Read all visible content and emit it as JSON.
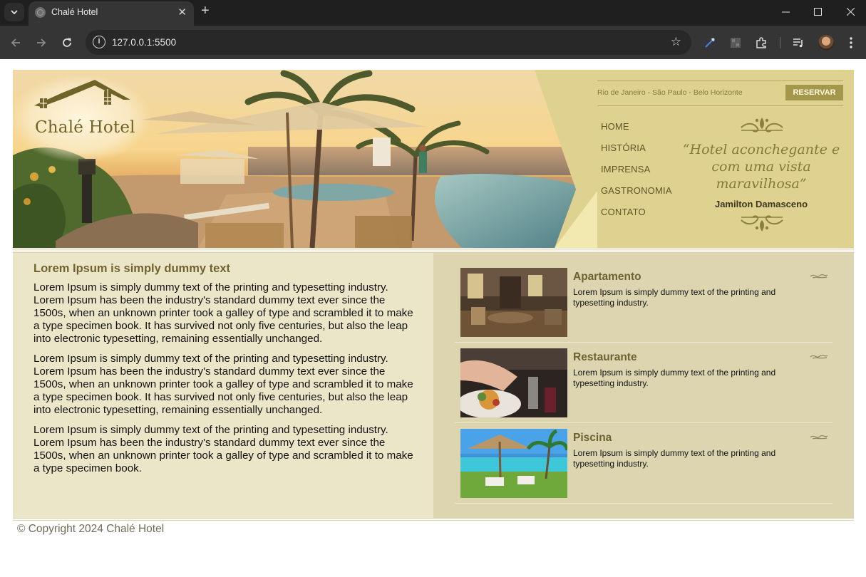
{
  "browser": {
    "tab_title": "Chalé Hotel",
    "url": "127.0.0.1:5500"
  },
  "site": {
    "logo_text": "Chalé Hotel",
    "cities": "Rio de Janeiro - São Paulo - Belo Horizonte",
    "reserve_label": "RESERVAR",
    "nav": [
      "HOME",
      "HISTÓRIA",
      "IMPRENSA",
      "GASTRONOMIA",
      "CONTATO"
    ],
    "quote": "“Hotel aconchegante e com uma vista maravilhosa”",
    "quote_author": "Jamilton Damasceno",
    "main_title": "Lorem Ipsum is simply dummy text",
    "paragraphs": [
      "Lorem Ipsum is simply dummy text of the printing and typesetting industry. Lorem Ipsum has been the industry's standard dummy text ever since the 1500s, when an unknown printer took a galley of type and scrambled it to make a type specimen book. It has survived not only five centuries, but also the leap into electronic typesetting, remaining essentially unchanged.",
      "Lorem Ipsum is simply dummy text of the printing and typesetting industry. Lorem Ipsum has been the industry's standard dummy text ever since the 1500s, when an unknown printer took a galley of type and scrambled it to make a type specimen book. It has survived not only five centuries, but also the leap into electronic typesetting, remaining essentially unchanged.",
      "Lorem Ipsum is simply dummy text of the printing and typesetting industry. Lorem Ipsum has been the industry's standard dummy text ever since the 1500s, when an unknown printer took a galley of type and scrambled it to make a type specimen book."
    ],
    "features": [
      {
        "title": "Apartamento",
        "desc": "Lorem Ipsum is simply dummy text of the printing and typesetting industry."
      },
      {
        "title": "Restaurante",
        "desc": "Lorem Ipsum is simply dummy text of the printing and typesetting industry."
      },
      {
        "title": "Piscina",
        "desc": "Lorem Ipsum is simply dummy text of the printing and typesetting industry."
      }
    ],
    "copyright": "© Copyright 2024 Chalé Hotel"
  },
  "colors": {
    "header_bg": "#dfd290",
    "accent": "#a4964a",
    "content_left": "#ece6c8",
    "content_right": "#dcd5b0",
    "title": "#6f6430"
  },
  "icons": [
    "tab-list-icon",
    "favicon-icon",
    "close-icon",
    "plus-icon",
    "minimize-icon",
    "maximize-icon",
    "back-icon",
    "forward-icon",
    "reload-icon",
    "info-icon",
    "star-icon",
    "eyedropper-icon",
    "extension-icon",
    "puzzle-icon",
    "media-icon",
    "avatar",
    "menu-icon",
    "ornament-icon"
  ]
}
